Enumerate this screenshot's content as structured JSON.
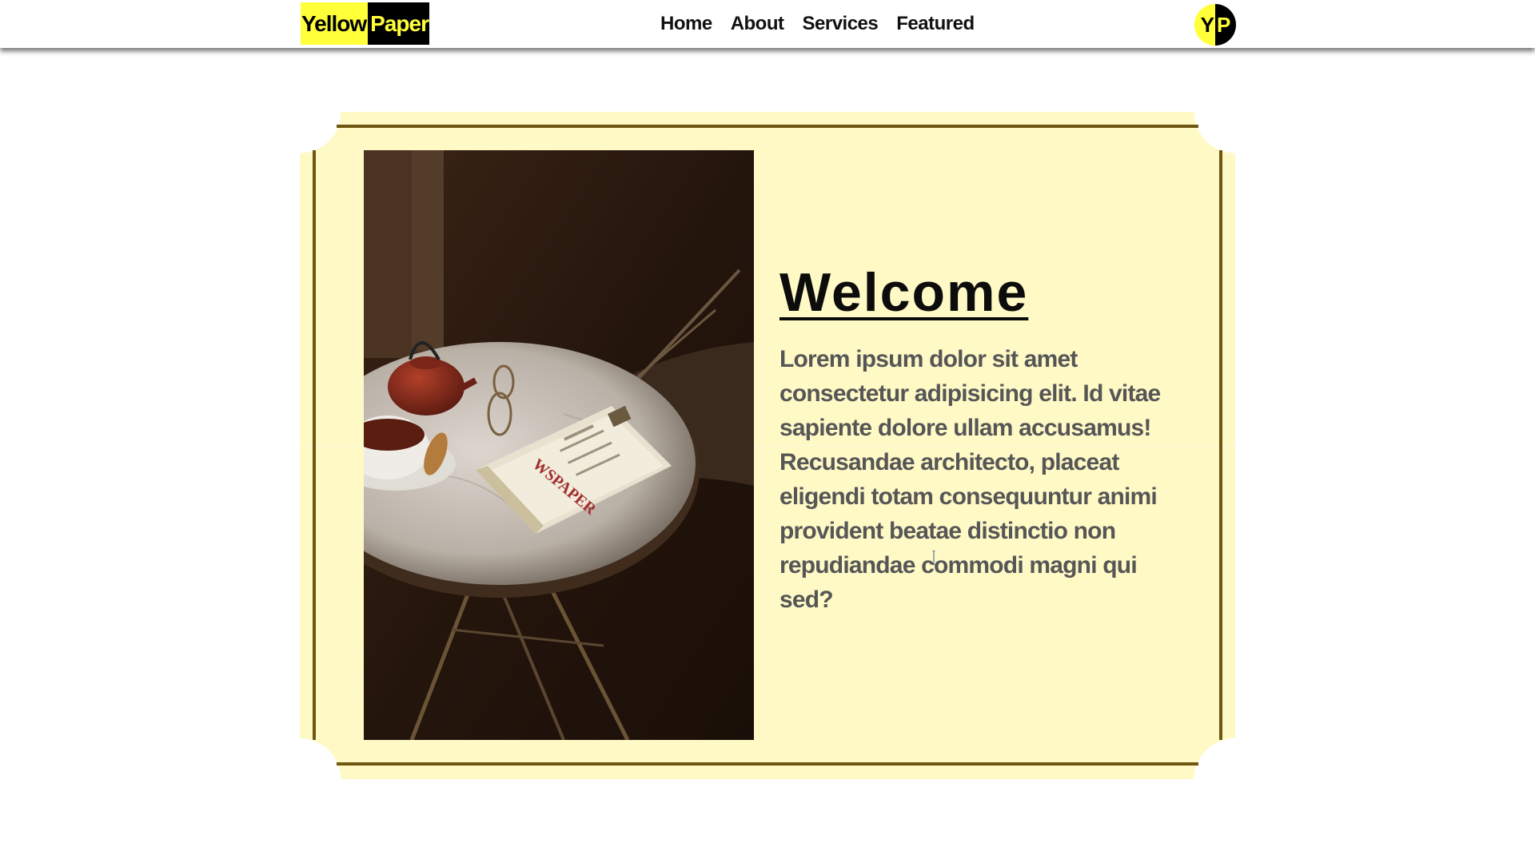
{
  "header": {
    "logo": {
      "part1": "Yellow",
      "part2": "Paper"
    },
    "nav": [
      {
        "label": "Home"
      },
      {
        "label": "About"
      },
      {
        "label": "Services"
      },
      {
        "label": "Featured"
      }
    ],
    "badge": {
      "left": "Y",
      "right": "P"
    }
  },
  "main": {
    "title": "Welcome",
    "paragraph": "Lorem ipsum dolor sit amet consectetur adipisicing elit. Id vitae sapiente dolore ullam accusamus! Recusandae architecto, placeat eligendi totam consequuntur animi provident beatae distinctio non repudiandae commodi magni qui sed?",
    "image_icon": "newspaper-tea-table-photo"
  },
  "colors": {
    "brand_yellow": "#ffff3a",
    "brand_black": "#000000",
    "card_background": "#fff9c6",
    "card_rule": "#6f5711",
    "title_text": "#0c0c0c",
    "body_text": "#565656"
  }
}
